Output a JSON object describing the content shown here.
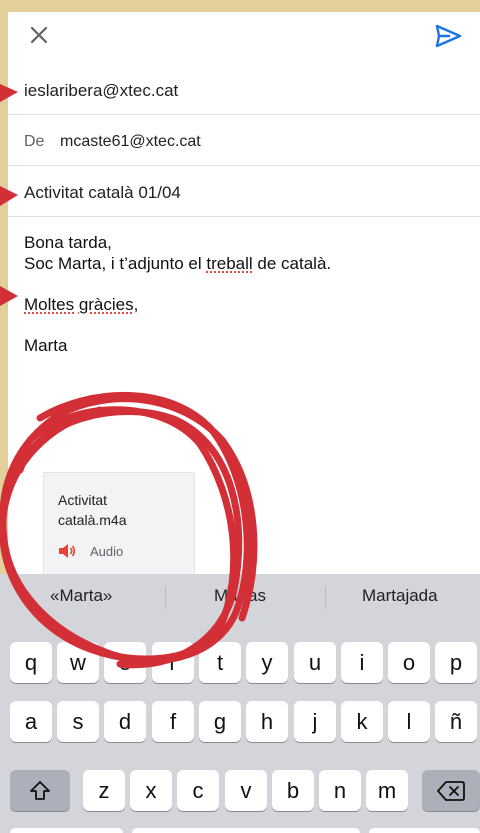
{
  "header": {
    "close_icon": "close-icon",
    "send_icon": "send-icon"
  },
  "compose": {
    "to": "ieslaribera@xtec.cat",
    "from_label": "De",
    "from": "mcaste61@xtec.cat",
    "subject": "Activitat català 01/04",
    "body": {
      "line1": "Bona tarda,",
      "line2_pre": "Soc Marta, i t’adjunto el ",
      "line2_word": "treball",
      "line2_post": " de català.",
      "thanks_word1": "Moltes",
      "thanks_word2": "gràcies",
      "thanks_end": ",",
      "signature": "Marta"
    }
  },
  "attachment": {
    "name_line1": "Activitat",
    "name_line2": "català.m4a",
    "type": "Audio",
    "icon": "speaker-icon"
  },
  "keyboard": {
    "suggestions": [
      "«Marta»",
      "Martas",
      "Martajada"
    ],
    "row1": [
      "q",
      "w",
      "e",
      "r",
      "t",
      "y",
      "u",
      "i",
      "o",
      "p"
    ],
    "row2": [
      "a",
      "s",
      "d",
      "f",
      "g",
      "h",
      "j",
      "k",
      "l",
      "ñ"
    ],
    "row3": [
      "z",
      "x",
      "c",
      "v",
      "b",
      "n",
      "m"
    ],
    "shift_icon": "shift-icon",
    "backspace_icon": "backspace-icon"
  },
  "colors": {
    "background": "#e3cf9a",
    "send_accent": "#1a73e8",
    "annotation": "#d32f37"
  }
}
